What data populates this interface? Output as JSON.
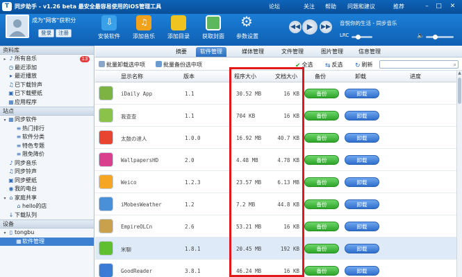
{
  "titlebar": {
    "title": "同步助手 - v1.26 beta  最安全最容易使用的iOS管理工具",
    "links": [
      "论坛",
      "关注",
      "帮助",
      "问题和建议",
      "推荐"
    ]
  },
  "user": {
    "status": "成为\"网客\"获积分",
    "login_label": "登录",
    "register_label": "注册"
  },
  "toolbar": {
    "buttons": [
      {
        "label": "安装软件",
        "icon": "install-icon",
        "color": "#3aa0e8"
      },
      {
        "label": "添加音乐",
        "icon": "music-icon",
        "color": "#f0a21c"
      },
      {
        "label": "添加目录",
        "icon": "folder-icon",
        "color": "#f0c420"
      },
      {
        "label": "获取封面",
        "icon": "cover-icon",
        "color": "#5cb85c"
      },
      {
        "label": "参数设置",
        "icon": "gear-icon",
        "color": "#eef3f9"
      }
    ],
    "now_playing": "音悦你的生活 - 同步音乐",
    "lrc_label": "LRC"
  },
  "sidebar": {
    "sections": [
      {
        "title": "资料库",
        "items": [
          {
            "label": "所有音乐",
            "badge": "13",
            "icon": "music-note-icon",
            "indent": 0,
            "arrow": "▸"
          },
          {
            "label": "最近添加",
            "icon": "clock-icon",
            "indent": 0,
            "arrow": ""
          },
          {
            "label": "最近播放",
            "icon": "play-icon",
            "indent": 0,
            "arrow": ""
          },
          {
            "label": "已下载铃声",
            "icon": "bell-icon",
            "indent": 0,
            "arrow": ""
          },
          {
            "label": "已下载壁纸",
            "icon": "image-icon",
            "indent": 0,
            "arrow": ""
          },
          {
            "label": "应用程序",
            "icon": "app-icon",
            "indent": 0,
            "arrow": ""
          }
        ]
      },
      {
        "title": "站点",
        "items": [
          {
            "label": "同步软件",
            "icon": "app-icon",
            "indent": 0,
            "arrow": "▾"
          },
          {
            "label": "热门排行",
            "icon": "list-icon",
            "indent": 1,
            "arrow": ""
          },
          {
            "label": "软件分类",
            "icon": "list-icon",
            "indent": 1,
            "arrow": ""
          },
          {
            "label": "特色专题",
            "icon": "list-icon",
            "indent": 1,
            "arrow": ""
          },
          {
            "label": "限免降价",
            "icon": "list-icon",
            "indent": 1,
            "arrow": ""
          },
          {
            "label": "同步音乐",
            "icon": "music-note-icon",
            "indent": 0,
            "arrow": ""
          },
          {
            "label": "同步铃声",
            "icon": "bell-icon",
            "indent": 0,
            "arrow": ""
          },
          {
            "label": "同步壁纸",
            "icon": "image-icon",
            "indent": 0,
            "arrow": ""
          },
          {
            "label": "我的电台",
            "icon": "radio-icon",
            "indent": 0,
            "arrow": ""
          },
          {
            "label": "家庭共享",
            "icon": "home-icon",
            "indent": 0,
            "arrow": "▾"
          },
          {
            "label": "hello的店",
            "icon": "home-icon",
            "indent": 1,
            "arrow": ""
          },
          {
            "label": "下载队列",
            "icon": "download-icon",
            "indent": 0,
            "arrow": ""
          }
        ]
      },
      {
        "title": "设备",
        "items": [
          {
            "label": "tongbu",
            "icon": "phone-icon",
            "indent": 0,
            "arrow": "▾"
          },
          {
            "label": "软件管理",
            "icon": "app-icon",
            "indent": 1,
            "arrow": "",
            "selected": true
          }
        ]
      }
    ]
  },
  "tabs": [
    "摘要",
    "软件管理",
    "媒体管理",
    "文件管理",
    "图片管理",
    "信息管理"
  ],
  "active_tab": 1,
  "actions": {
    "batch_uninstall": "批量卸载选中项",
    "batch_backup": "批量备份选中项",
    "select_all": "全选",
    "invert": "反选",
    "refresh": "刷新"
  },
  "table": {
    "headers": [
      "显示名称",
      "版本",
      "程序大小",
      "文档大小",
      "备份",
      "卸载",
      "进度"
    ],
    "backup_label": "备份",
    "uninstall_label": "卸载",
    "rows": [
      {
        "name": "iDaily App",
        "version": "1.1",
        "app_size": "30.52 MB",
        "doc_size": "16 KB",
        "icon_color": "#7cb342",
        "highlight": false
      },
      {
        "name": "我查查",
        "version": "1.1",
        "app_size": "704 KB",
        "doc_size": "16 KB",
        "icon_color": "#8bc34a",
        "highlight": false
      },
      {
        "name": "太鼓の達人",
        "version": "1.0.0",
        "app_size": "16.92 MB",
        "doc_size": "40.7 KB",
        "icon_color": "#e8442f",
        "highlight": false
      },
      {
        "name": "WallpapersHD",
        "version": "2.0",
        "app_size": "4.48 MB",
        "doc_size": "4.78 KB",
        "icon_color": "#d93f8c",
        "highlight": false
      },
      {
        "name": "Weico",
        "version": "1.2.3",
        "app_size": "23.57 MB",
        "doc_size": "6.13 MB",
        "icon_color": "#f5a623",
        "highlight": false
      },
      {
        "name": "iMobesWeather",
        "version": "1.2",
        "app_size": "7.2 MB",
        "doc_size": "44.8 KB",
        "icon_color": "#4a90d9",
        "highlight": false
      },
      {
        "name": "EmpireOLCn",
        "version": "2.6",
        "app_size": "53.21 MB",
        "doc_size": "16 KB",
        "icon_color": "#c9a04b",
        "highlight": false
      },
      {
        "name": "米聊",
        "version": "1.8.1",
        "app_size": "20.45 MB",
        "doc_size": "192 KB",
        "icon_color": "#5fbf2f",
        "highlight": true
      },
      {
        "name": "GoodReader",
        "version": "3.8.1",
        "app_size": "46.24 MB",
        "doc_size": "16 KB",
        "icon_color": "#3a7bd5",
        "highlight": false
      }
    ]
  },
  "colors": {
    "title_bar": "#0d63b8",
    "highlight_box": "#e0181c",
    "backup_button": "#3cae37",
    "uninstall_button": "#2f6fcc"
  }
}
